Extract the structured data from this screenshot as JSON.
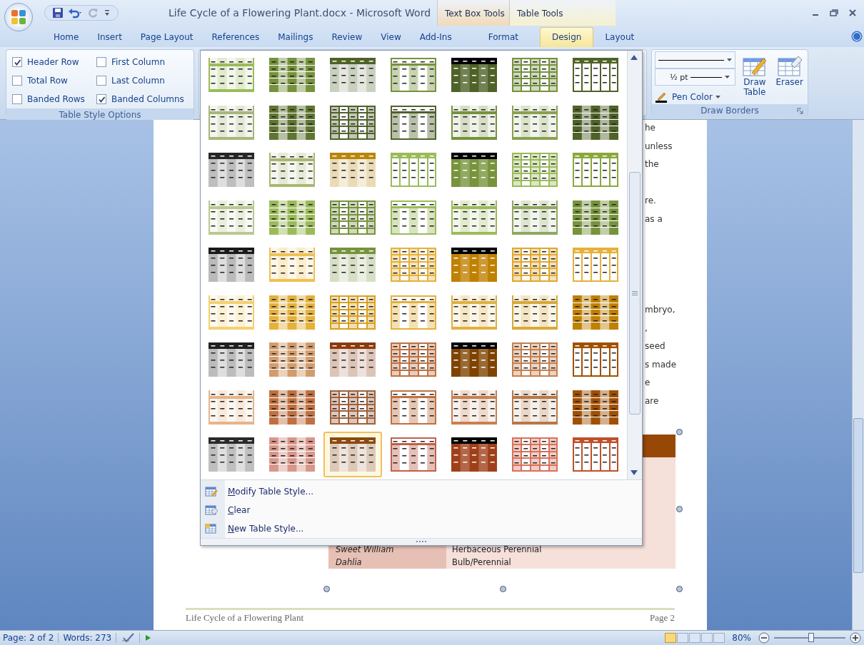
{
  "title_bar": {
    "title": "Life Cycle of a Flowering Plant.docx - Microsoft Word",
    "contextual_tabs": [
      {
        "label": "Text Box Tools"
      },
      {
        "label": "Table Tools"
      }
    ]
  },
  "ribbon_tabs": [
    {
      "label": "Home",
      "kind": "standard",
      "selected": false
    },
    {
      "label": "Insert",
      "kind": "standard",
      "selected": false
    },
    {
      "label": "Page Layout",
      "kind": "standard",
      "selected": false
    },
    {
      "label": "References",
      "kind": "standard",
      "selected": false
    },
    {
      "label": "Mailings",
      "kind": "standard",
      "selected": false
    },
    {
      "label": "Review",
      "kind": "standard",
      "selected": false
    },
    {
      "label": "View",
      "kind": "standard",
      "selected": false
    },
    {
      "label": "Add-Ins",
      "kind": "standard",
      "selected": false
    },
    {
      "label": "Format",
      "kind": "contextual",
      "selected": false
    },
    {
      "label": "Design",
      "kind": "contextual",
      "selected": true
    },
    {
      "label": "Layout",
      "kind": "contextual",
      "selected": false
    }
  ],
  "table_style_options": {
    "label": "Table Style Options",
    "options": [
      {
        "label": "Header Row",
        "checked": true
      },
      {
        "label": "Total Row",
        "checked": false
      },
      {
        "label": "Banded Rows",
        "checked": false
      },
      {
        "label": "First Column",
        "checked": false
      },
      {
        "label": "Last Column",
        "checked": false
      },
      {
        "label": "Banded Columns",
        "checked": true
      }
    ]
  },
  "draw_borders": {
    "label": "Draw Borders",
    "pen_weight": "½ pt",
    "pen_color": "Pen Color",
    "draw_table": "Draw Table",
    "eraser": "Eraser"
  },
  "style_gallery": {
    "rows": [
      [
        {
          "kind": "light",
          "color": "#9bbb59",
          "selected": false
        },
        {
          "kind": "shaded",
          "color": "#76923c",
          "selected": false
        },
        {
          "kind": "header",
          "color": "#4f6228",
          "selected": false
        },
        {
          "kind": "banded",
          "color": "#76923c",
          "selected": false
        },
        {
          "kind": "dark",
          "color": "#4f6228",
          "selected": false
        },
        {
          "kind": "grid",
          "color": "#76923c",
          "selected": false
        },
        {
          "kind": "lined",
          "color": "#4f6228",
          "selected": false
        }
      ],
      [
        {
          "kind": "light",
          "color": "#a6b77a",
          "selected": false
        },
        {
          "kind": "shaded",
          "color": "#5f7530",
          "selected": false
        },
        {
          "kind": "grid",
          "color": "#4f6228",
          "selected": false
        },
        {
          "kind": "banded",
          "color": "#4f6228",
          "selected": false
        },
        {
          "kind": "light",
          "color": "#76923c",
          "selected": false
        },
        {
          "kind": "light",
          "color": "#8aa050",
          "selected": false
        },
        {
          "kind": "shaded",
          "color": "#4f6228",
          "selected": false
        }
      ],
      [
        {
          "kind": "header",
          "color": "#262626",
          "selected": false
        },
        {
          "kind": "light",
          "color": "#a9b872",
          "selected": false
        },
        {
          "kind": "header",
          "color": "#b8860b",
          "selected": false
        },
        {
          "kind": "lined",
          "color": "#9bbb59",
          "selected": false
        },
        {
          "kind": "dark",
          "color": "#77933c",
          "selected": false
        },
        {
          "kind": "grid",
          "color": "#9bbb59",
          "selected": false
        },
        {
          "kind": "lined",
          "color": "#8aa83c",
          "selected": false
        }
      ],
      [
        {
          "kind": "light",
          "color": "#b9c98f",
          "selected": false
        },
        {
          "kind": "shaded",
          "color": "#9bbb59",
          "selected": false
        },
        {
          "kind": "grid",
          "color": "#77933c",
          "selected": false
        },
        {
          "kind": "banded",
          "color": "#9bbb59",
          "selected": false
        },
        {
          "kind": "light",
          "color": "#9bbb59",
          "selected": false
        },
        {
          "kind": "light",
          "color": "#8fa860",
          "selected": false
        },
        {
          "kind": "shaded",
          "color": "#77933c",
          "selected": false
        }
      ],
      [
        {
          "kind": "header",
          "color": "#1a1a1a",
          "selected": false
        },
        {
          "kind": "light",
          "color": "#f0c050",
          "selected": false
        },
        {
          "kind": "header",
          "color": "#77933c",
          "selected": false
        },
        {
          "kind": "grid",
          "color": "#e5b13a",
          "selected": false
        },
        {
          "kind": "dark",
          "color": "#c08000",
          "selected": false
        },
        {
          "kind": "grid",
          "color": "#e0a830",
          "selected": false
        },
        {
          "kind": "lined",
          "color": "#e5b13a",
          "selected": false
        }
      ],
      [
        {
          "kind": "light",
          "color": "#f5cf70",
          "selected": false
        },
        {
          "kind": "shaded",
          "color": "#e5b13a",
          "selected": false
        },
        {
          "kind": "grid",
          "color": "#d9a020",
          "selected": false
        },
        {
          "kind": "banded",
          "color": "#e5b13a",
          "selected": false
        },
        {
          "kind": "light",
          "color": "#e0b040",
          "selected": false
        },
        {
          "kind": "light",
          "color": "#d8a838",
          "selected": false
        },
        {
          "kind": "shaded",
          "color": "#c08000",
          "selected": false
        }
      ],
      [
        {
          "kind": "header",
          "color": "#202020",
          "selected": false
        },
        {
          "kind": "shaded",
          "color": "#d39c6c",
          "selected": false
        },
        {
          "kind": "header",
          "color": "#8b3a0e",
          "selected": false
        },
        {
          "kind": "grid",
          "color": "#c07040",
          "selected": false
        },
        {
          "kind": "dark",
          "color": "#7f4300",
          "selected": false
        },
        {
          "kind": "grid",
          "color": "#c58050",
          "selected": false
        },
        {
          "kind": "lined",
          "color": "#a05000",
          "selected": false
        }
      ],
      [
        {
          "kind": "light",
          "color": "#e6b48a",
          "selected": false
        },
        {
          "kind": "shaded",
          "color": "#c07040",
          "selected": false
        },
        {
          "kind": "grid",
          "color": "#a0603a",
          "selected": false
        },
        {
          "kind": "banded",
          "color": "#c07040",
          "selected": false
        },
        {
          "kind": "light",
          "color": "#c88050",
          "selected": false
        },
        {
          "kind": "light",
          "color": "#b87848",
          "selected": false
        },
        {
          "kind": "shaded",
          "color": "#a05000",
          "selected": false
        }
      ],
      [
        {
          "kind": "header",
          "color": "#2a2a2a",
          "selected": false
        },
        {
          "kind": "shaded",
          "color": "#d9968a",
          "selected": false
        },
        {
          "kind": "header",
          "color": "#8b4a10",
          "selected": true
        },
        {
          "kind": "banded",
          "color": "#c0604a",
          "selected": false
        },
        {
          "kind": "dark",
          "color": "#a0401a",
          "selected": false
        },
        {
          "kind": "grid",
          "color": "#d9705a",
          "selected": false
        },
        {
          "kind": "lined",
          "color": "#c0502a",
          "selected": false
        }
      ]
    ],
    "commands": [
      {
        "label": "Modify Table Style...",
        "kind": "modify"
      },
      {
        "label": "Clear",
        "kind": "clear"
      },
      {
        "label": "New Table Style...",
        "kind": "new"
      }
    ]
  },
  "document": {
    "fragments": [
      "he",
      "unless",
      "the",
      "re.",
      "as a",
      "mbryo,",
      ",",
      "seed",
      "s made",
      "e",
      "are"
    ],
    "table_rows": [
      [
        "Sweet William",
        "Herbaceous Perennial"
      ],
      [
        "Dahlia",
        "Bulb/Perennial"
      ]
    ],
    "footer_title": "Life Cycle of a Flowering Plant",
    "footer_page": "Page 2"
  },
  "status_bar": {
    "page": "Page: 2 of 2",
    "words": "Words: 273",
    "zoom": "80%",
    "zoom_slider": {
      "level": 0.52
    }
  }
}
